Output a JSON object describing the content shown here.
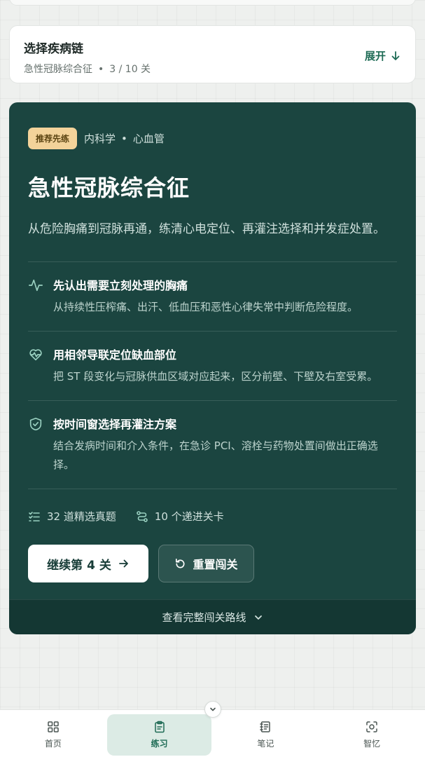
{
  "chain": {
    "title": "选择疾病链",
    "disease": "急性冠脉综合征",
    "separator": "•",
    "progress": "3 / 10 关",
    "expand_label": "展开"
  },
  "card": {
    "tag": "推荐先练",
    "category_major": "内科学",
    "category_sep": "•",
    "category_minor": "心血管",
    "title": "急性冠脉综合征",
    "description": "从危险胸痛到冠脉再通，练清心电定位、再灌注选择和并发症处置。",
    "features": [
      {
        "icon": "heartbeat-icon",
        "title": "先认出需要立刻处理的胸痛",
        "desc": "从持续性压榨痛、出汗、低血压和恶性心律失常中判断危险程度。"
      },
      {
        "icon": "heart-pulse-icon",
        "title": "用相邻导联定位缺血部位",
        "desc": "把 ST 段变化与冠脉供血区域对应起来，区分前壁、下壁及右室受累。"
      },
      {
        "icon": "shield-check-icon",
        "title": "按时间窗选择再灌注方案",
        "desc": "结合发病时间和介入条件，在急诊 PCI、溶栓与药物处置间做出正确选择。"
      }
    ],
    "stats": {
      "questions": "32 道精选真题",
      "levels": "10 个递进关卡"
    },
    "continue_label": "继续第 4 关",
    "reset_label": "重置闯关",
    "route_label": "查看完整闯关路线"
  },
  "nav": {
    "items": [
      {
        "label": "首页",
        "icon": "grid-icon"
      },
      {
        "label": "练习",
        "icon": "clipboard-icon"
      },
      {
        "label": "笔记",
        "icon": "notebook-icon"
      },
      {
        "label": "智忆",
        "icon": "memory-scan-icon"
      }
    ],
    "active_index": 1
  },
  "colors": {
    "accent": "#1e6b55",
    "card_bg": "#1b4540",
    "tag_bg": "#f3d39a"
  }
}
